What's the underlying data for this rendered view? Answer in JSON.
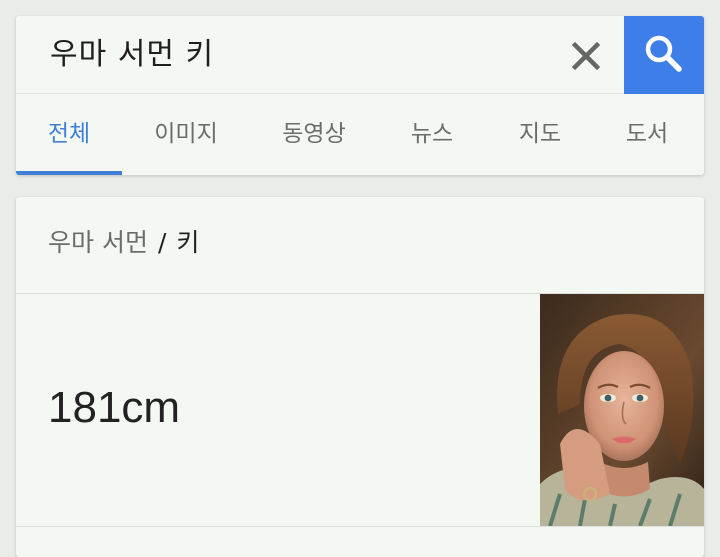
{
  "search": {
    "query": "우마 서먼 키",
    "clear_icon": "close-icon",
    "search_icon": "search-icon",
    "accent_color": "#3e7ee8"
  },
  "tabs": [
    {
      "label": "전체",
      "active": true
    },
    {
      "label": "이미지",
      "active": false
    },
    {
      "label": "동영상",
      "active": false
    },
    {
      "label": "뉴스",
      "active": false
    },
    {
      "label": "지도",
      "active": false
    },
    {
      "label": "도서",
      "active": false
    }
  ],
  "result": {
    "breadcrumb_parent": "우마 서먼",
    "breadcrumb_separator": "/",
    "breadcrumb_current": "키",
    "answer": "181cm",
    "photo": "portrait-photo"
  }
}
